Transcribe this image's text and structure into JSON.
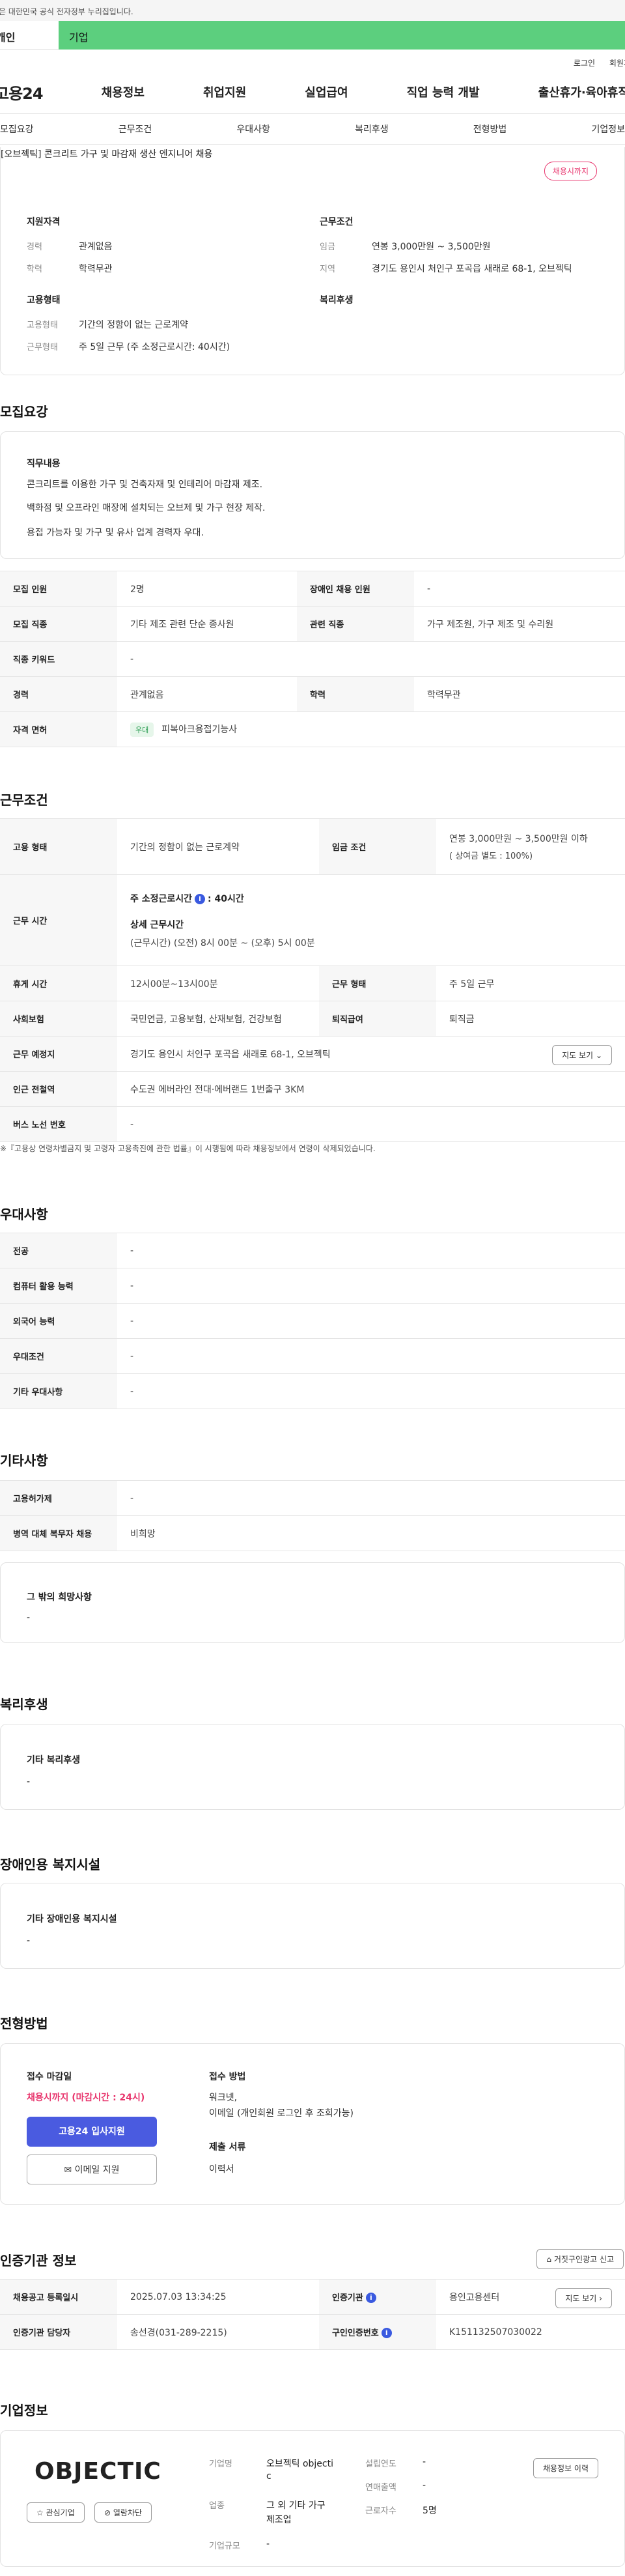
{
  "gov_bar": "이 누리집은 대한민국 공식 전자정부 누리집입니다.",
  "user_tabs": {
    "personal": "개인",
    "company": "기업"
  },
  "util": {
    "login": "로그인",
    "join": "회원가입"
  },
  "gnb": {
    "logo": "고용24",
    "menus": [
      "채용정보",
      "취업지원",
      "실업급여",
      "직업 능력 개발",
      "출산휴가·육아휴직"
    ]
  },
  "subnav": [
    "모집요강",
    "근무조건",
    "우대사항",
    "복리후생",
    "전형방법",
    "기업정보"
  ],
  "summary": {
    "title": "[오브젝틱] 콘크리트 가구 및 마감재 생산 엔지니어 채용",
    "badge": "채용시까지",
    "qual_title": "지원자격",
    "qual": [
      {
        "k": "경력",
        "v": "관계없음"
      },
      {
        "k": "학력",
        "v": "학력무관"
      }
    ],
    "cond_title": "근무조건",
    "cond": [
      {
        "k": "임금",
        "v": "연봉 3,000만원 ~ 3,500만원"
      },
      {
        "k": "지역",
        "v": "경기도 용인시 처인구 포곡읍 새래로 68-1, 오브젝틱"
      }
    ],
    "emp_title": "고용형태",
    "emp": [
      {
        "k": "고용형태",
        "v": "기간의 정함이 없는 근로계약"
      },
      {
        "k": "근무형태",
        "v": "주 5일 근무 (주 소정근로시간: 40시간)"
      }
    ],
    "welfare_title": "복리후생"
  },
  "recruit": {
    "title": "모집요강",
    "duty_title": "직무내용",
    "duty_lines": [
      "콘크리트를 이용한 가구 및 건축자재 및 인테리어 마감재 제조.",
      "백화점 및 오프라인 매장에 설치되는 오브제 및 가구 현장 제작.",
      "용접 가능자 및 가구 및 유사 업계 경력자 우대."
    ],
    "rows": {
      "headcount_h": "모집 인원",
      "headcount": "2명",
      "disabled_h": "장애인 채용 인원",
      "disabled": "-",
      "job_h": "모집 직종",
      "job": "기타 제조 관련 단순 종사원",
      "related_h": "관련 직종",
      "related": "가구 제조원, 가구 제조 및 수리원",
      "keyword_h": "직종 키워드",
      "keyword": "-",
      "career_h": "경력",
      "career": "관계없음",
      "edu_h": "학력",
      "edu": "학력무관",
      "license_h": "자격 면허",
      "license_tag": "우대",
      "license": "피복아크용접기능사"
    }
  },
  "work": {
    "title": "근무조건",
    "emptype_h": "고용 형태",
    "emptype": "기간의 정함이 없는 근로계약",
    "wage_h": "임금 조건",
    "wage": "연봉 3,000만원 ~ 3,500만원 이하",
    "wage_sub": "( 상여금 별도 : 100%)",
    "hours_h": "근무 시간",
    "hours_std": "주 소정근로시간",
    "hours_std_val": ": 40시간",
    "hours_detail_t": "상세 근무시간",
    "hours_detail": "(근무시간) (오전) 8시 00분 ~ (오후) 5시 00분",
    "rest_h": "휴게 시간",
    "rest": "12시00분~13시00분",
    "worktype_h": "근무 형태",
    "worktype": "주 5일 근무",
    "ins_h": "사회보험",
    "ins": "국민연금, 고용보험, 산재보험, 건강보험",
    "sev_h": "퇴직급여",
    "sev": "퇴직금",
    "place_h": "근무 예정지",
    "place": "경기도 용인시 처인구 포곡읍 새래로 68-1, 오브젝틱",
    "map_btn": "지도 보기",
    "subway_h": "인근 전철역",
    "subway": "수도권 에버라인 전대·에버랜드 1번출구 3KM",
    "bus_h": "버스 노선 번호",
    "bus": "-",
    "note": "※『고용상 연령차별금지 및 고령자 고용촉진에 관한 법률』이 시행됨에 따라 채용정보에서 연령이 삭제되었습니다."
  },
  "pref": {
    "title": "우대사항",
    "rows": [
      {
        "h": "전공",
        "v": "-"
      },
      {
        "h": "컴퓨터 활용 능력",
        "v": "-"
      },
      {
        "h": "외국어 능력",
        "v": "-"
      },
      {
        "h": "우대조건",
        "v": "-"
      },
      {
        "h": "기타 우대사항",
        "v": "-"
      }
    ]
  },
  "etc": {
    "title": "기타사항",
    "rows": [
      {
        "h": "고용허가제",
        "v": "-"
      },
      {
        "h": "병역 대체 복무자 채용",
        "v": "비희망"
      }
    ],
    "wish_t": "그 밖의 희망사항",
    "wish": "-"
  },
  "welfare": {
    "title": "복리후생",
    "box_t": "기타 복리후생",
    "box_v": "-"
  },
  "disabled_fac": {
    "title": "장애인용 복지시설",
    "box_t": "기타 장애인용 복지시설",
    "box_v": "-"
  },
  "process": {
    "title": "전형방법",
    "deadline_t": "접수 마감일",
    "deadline": "채용시까지 (마감시간 : 24시)",
    "apply_btn": "고용24 입사지원",
    "email_btn": "이메일 지원",
    "method_t": "접수 방법",
    "method_1": "워크넷,",
    "method_2": "이메일 (개인회원 로그인 후 조회가능)",
    "docs_t": "제출 서류",
    "docs": "이력서"
  },
  "agency": {
    "title": "인증기관 정보",
    "report_btn": "거짓구인광고 신고",
    "reg_h": "채용공고 등록일시",
    "reg": "2025.07.03 13:34:25",
    "org_h": "인증기관",
    "org": "용인고용센터",
    "map_btn": "지도 보기",
    "mgr_h": "인증기관 담당자",
    "mgr": "송선경(031-289-2215)",
    "no_h": "구인인증번호",
    "no": "K151132507030022"
  },
  "company": {
    "title": "기업정보",
    "logo_text": "OBJECTIC",
    "fav_btn": "관심기업",
    "block_btn": "열람차단",
    "name_h": "기업명",
    "name_1": "오브젝틱 objecti",
    "name_2": "c",
    "founded_h": "설립연도",
    "founded": "-",
    "sales_h": "연매출액",
    "sales": "-",
    "industry_h": "업종",
    "industry_1": "그 외 기타 가구",
    "industry_2": "제조업",
    "staff_h": "근로자수",
    "staff": "5명",
    "size_h": "기업규모",
    "size": "-",
    "resume_btn": "채용정보 이력"
  }
}
